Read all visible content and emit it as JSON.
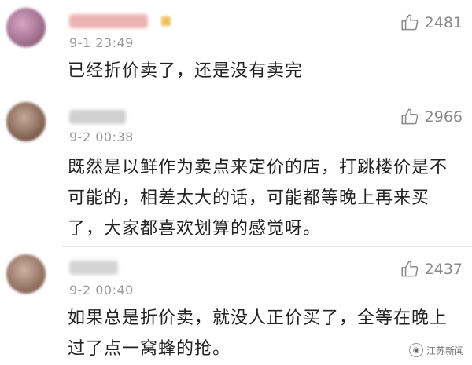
{
  "comments": [
    {
      "time": "9-1 23:49",
      "likes": "2481",
      "text": "已经折价卖了，还是没有卖完",
      "avatar_color": "#b07a9a",
      "name_color": "#e9a9a9"
    },
    {
      "time": "9-2 00:38",
      "likes": "2966",
      "text": "既然是以鲜作为卖点来定价的店，打跳楼价是不可能的，相差太大的话，可能都等晚上再来买了，大家都喜欢划算的感觉呀。",
      "avatar_color": "#8a6a5a",
      "name_color": "#c7c7c7"
    },
    {
      "time": "9-2 00:40",
      "likes": "2437",
      "text": "如果总是折价卖，就没人正价买了，全等在晚上过了点一窝蜂的抢。",
      "avatar_color": "#9a7a6a",
      "name_color": "#cfcfcf"
    }
  ],
  "watermark": {
    "label": "江苏新闻"
  },
  "icons": {
    "like": "thumbs-up-icon",
    "watermark": "wechat-icon"
  }
}
